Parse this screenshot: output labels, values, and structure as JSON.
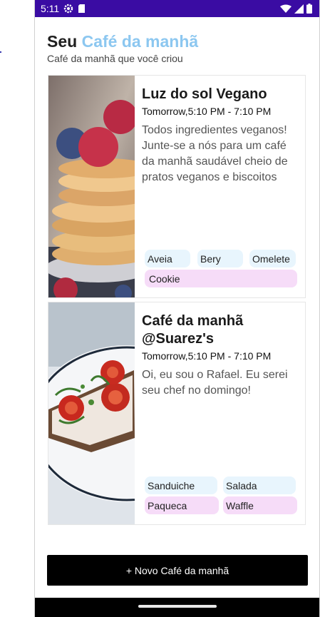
{
  "status_bar": {
    "time": "5:11"
  },
  "header": {
    "title_prefix": "Seu ",
    "title_accent": "Café da manhã",
    "subtitle": "Café da manhã que você criou"
  },
  "cards": [
    {
      "title": "Luz do sol Vegano",
      "time": "Tomorrow,5:10 PM - 7:10 PM",
      "description": "Todos ingredientes veganos! Junte-se a nós para um café da manhã saudável cheio de pratos veganos e biscoitos",
      "tags": [
        "Aveia",
        "Bery",
        "Omelete",
        "Cookie"
      ]
    },
    {
      "title": "Café da manhã @Suarez's",
      "time": "Tomorrow,5:10 PM - 7:10 PM",
      "description": "Oi, eu sou o Rafael. Eu serei seu chef no domingo!",
      "tags": [
        "Sanduiche",
        "Salada",
        "Paqueca",
        "Waffle"
      ]
    }
  ],
  "new_button": {
    "label": "+ Novo Café da manhã"
  },
  "colors": {
    "status_bar": "#3a0ca3",
    "accent": "#8cc7f0",
    "tag_blue": "#e8f5fd",
    "tag_pink": "#f6dcf8",
    "button": "#000000"
  }
}
